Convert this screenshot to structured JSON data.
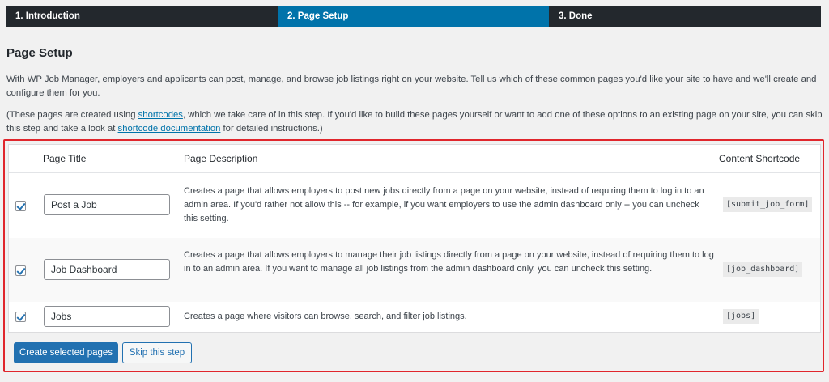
{
  "steps": [
    {
      "label": "1. Introduction",
      "active": false
    },
    {
      "label": "2. Page Setup",
      "active": true
    },
    {
      "label": "3. Done",
      "active": false
    }
  ],
  "page": {
    "title": "Page Setup",
    "intro": "With WP Job Manager, employers and applicants can post, manage, and browse job listings right on your website. Tell us which of these common pages you'd like your site to have and we'll create and configure them for you.",
    "note_prefix": "(These pages are created using ",
    "note_link1": "shortcodes",
    "note_middle": ", which we take care of in this step. If you'd like to build these pages yourself or want to add one of these options to an existing page on your site, you can skip this step and take a look at ",
    "note_link2": "shortcode documentation",
    "note_suffix": " for detailed instructions.)"
  },
  "table": {
    "headers": {
      "title": "Page Title",
      "description": "Page Description",
      "shortcode": "Content Shortcode"
    },
    "rows": [
      {
        "checked": true,
        "title": "Post a Job",
        "description": "Creates a page that allows employers to post new jobs directly from a page on your website, instead of requiring them to log in to an admin area. If you'd rather not allow this -- for example, if you want employers to use the admin dashboard only -- you can uncheck this setting.",
        "shortcode": "[submit_job_form]"
      },
      {
        "checked": true,
        "title": "Job Dashboard",
        "description": "Creates a page that allows employers to manage their job listings directly from a page on your website, instead of requiring them to log in to an admin area. If you want to manage all job listings from the admin dashboard only, you can uncheck this setting.",
        "shortcode": "[job_dashboard]"
      },
      {
        "checked": true,
        "title": "Jobs",
        "description": "Creates a page where visitors can browse, search, and filter job listings.",
        "shortcode": "[jobs]"
      }
    ]
  },
  "actions": {
    "create_label": "Create selected pages",
    "skip_label": "Skip this step"
  },
  "colors": {
    "active_step": "#0073aa",
    "step_bar": "#23282d",
    "primary_button": "#2271b1",
    "highlight_frame": "#e0262c"
  }
}
